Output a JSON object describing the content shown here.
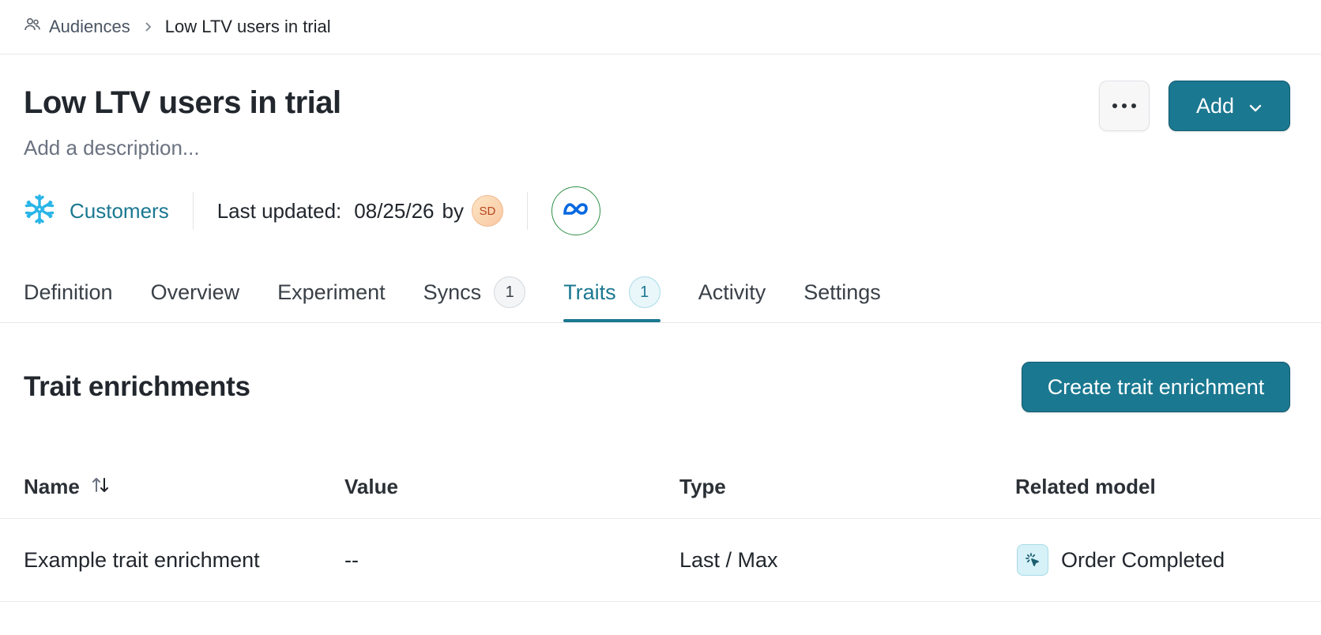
{
  "breadcrumb": {
    "root": "Audiences",
    "current": "Low LTV users in trial"
  },
  "header": {
    "title": "Low LTV users in trial",
    "description_placeholder": "Add a description...",
    "add_label": "Add"
  },
  "meta": {
    "source": "Customers",
    "last_updated_label": "Last updated:",
    "last_updated_date": "08/25/26",
    "by_label": "by",
    "avatar_initials": "SD"
  },
  "tabs": [
    {
      "label": "Definition"
    },
    {
      "label": "Overview"
    },
    {
      "label": "Experiment"
    },
    {
      "label": "Syncs",
      "badge": "1"
    },
    {
      "label": "Traits",
      "badge": "1",
      "active": true
    },
    {
      "label": "Activity"
    },
    {
      "label": "Settings"
    }
  ],
  "section": {
    "title": "Trait enrichments",
    "create_label": "Create trait enrichment"
  },
  "table": {
    "headers": {
      "name": "Name",
      "value": "Value",
      "type": "Type",
      "related_model": "Related model"
    },
    "rows": [
      {
        "name": "Example trait enrichment",
        "value": "--",
        "type": "Last / Max",
        "related_model": "Order Completed"
      }
    ]
  },
  "colors": {
    "accent": "#1b7891",
    "snowflake": "#29b5e8",
    "meta_blue": "#0668e1"
  }
}
